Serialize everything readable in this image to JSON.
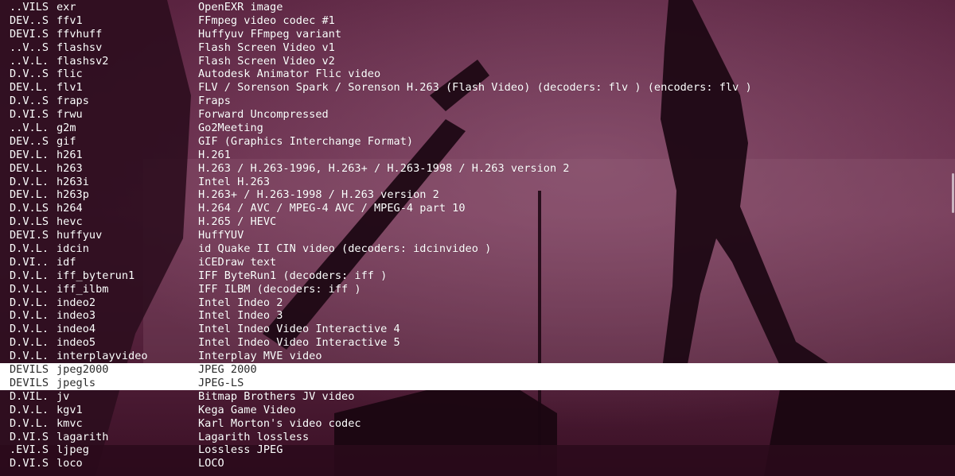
{
  "terminal": {
    "rows": [
      {
        "flags": "..VILS",
        "name": "exr",
        "desc": "OpenEXR image"
      },
      {
        "flags": "DEV..S",
        "name": "ffv1",
        "desc": "FFmpeg video codec #1"
      },
      {
        "flags": "DEVI.S",
        "name": "ffvhuff",
        "desc": "Huffyuv FFmpeg variant"
      },
      {
        "flags": "..V..S",
        "name": "flashsv",
        "desc": "Flash Screen Video v1"
      },
      {
        "flags": "..V.L.",
        "name": "flashsv2",
        "desc": "Flash Screen Video v2"
      },
      {
        "flags": "D.V..S",
        "name": "flic",
        "desc": "Autodesk Animator Flic video"
      },
      {
        "flags": "DEV.L.",
        "name": "flv1",
        "desc": "FLV / Sorenson Spark / Sorenson H.263 (Flash Video) (decoders: flv ) (encoders: flv )"
      },
      {
        "flags": "D.V..S",
        "name": "fraps",
        "desc": "Fraps"
      },
      {
        "flags": "D.VI.S",
        "name": "frwu",
        "desc": "Forward Uncompressed"
      },
      {
        "flags": "..V.L.",
        "name": "g2m",
        "desc": "Go2Meeting"
      },
      {
        "flags": "DEV..S",
        "name": "gif",
        "desc": "GIF (Graphics Interchange Format)"
      },
      {
        "flags": "DEV.L.",
        "name": "h261",
        "desc": "H.261"
      },
      {
        "flags": "DEV.L.",
        "name": "h263",
        "desc": "H.263 / H.263-1996, H.263+ / H.263-1998 / H.263 version 2"
      },
      {
        "flags": "D.V.L.",
        "name": "h263i",
        "desc": "Intel H.263"
      },
      {
        "flags": "DEV.L.",
        "name": "h263p",
        "desc": "H.263+ / H.263-1998 / H.263 version 2"
      },
      {
        "flags": "D.V.LS",
        "name": "h264",
        "desc": "H.264 / AVC / MPEG-4 AVC / MPEG-4 part 10"
      },
      {
        "flags": "D.V.LS",
        "name": "hevc",
        "desc": "H.265 / HEVC"
      },
      {
        "flags": "DEVI.S",
        "name": "huffyuv",
        "desc": "HuffYUV"
      },
      {
        "flags": "D.V.L.",
        "name": "idcin",
        "desc": "id Quake II CIN video (decoders: idcinvideo )"
      },
      {
        "flags": "D.VI..",
        "name": "idf",
        "desc": "iCEDraw text"
      },
      {
        "flags": "D.V.L.",
        "name": "iff_byterun1",
        "desc": "IFF ByteRun1 (decoders: iff )"
      },
      {
        "flags": "D.V.L.",
        "name": "iff_ilbm",
        "desc": "IFF ILBM (decoders: iff )"
      },
      {
        "flags": "D.V.L.",
        "name": "indeo2",
        "desc": "Intel Indeo 2"
      },
      {
        "flags": "D.V.L.",
        "name": "indeo3",
        "desc": "Intel Indeo 3"
      },
      {
        "flags": "D.V.L.",
        "name": "indeo4",
        "desc": "Intel Indeo Video Interactive 4"
      },
      {
        "flags": "D.V.L.",
        "name": "indeo5",
        "desc": "Intel Indeo Video Interactive 5"
      },
      {
        "flags": "D.V.L.",
        "name": "interplayvideo",
        "desc": "Interplay MVE video"
      },
      {
        "flags": "DEVILS",
        "name": "jpeg2000",
        "desc": "JPEG 2000"
      },
      {
        "flags": "DEVILS",
        "name": "jpegls",
        "desc": "JPEG-LS"
      },
      {
        "flags": "D.VIL.",
        "name": "jv",
        "desc": "Bitmap Brothers JV video"
      },
      {
        "flags": "D.V.L.",
        "name": "kgv1",
        "desc": "Kega Game Video"
      },
      {
        "flags": "D.V.L.",
        "name": "kmvc",
        "desc": "Karl Morton's video codec"
      },
      {
        "flags": "D.VI.S",
        "name": "lagarith",
        "desc": "Lagarith lossless"
      },
      {
        "flags": ".EVI.S",
        "name": "ljpeg",
        "desc": "Lossless JPEG"
      },
      {
        "flags": "D.VI.S",
        "name": "loco",
        "desc": "LOCO"
      }
    ],
    "selected_rows": [
      27,
      28
    ]
  },
  "colors": {
    "background": "#4a1733",
    "text": "#ffffff",
    "selection_bg": "#ffffff",
    "selection_text": "#2b2b2b"
  },
  "icons": {
    "scrollbar": "scrollbar-thumb"
  }
}
